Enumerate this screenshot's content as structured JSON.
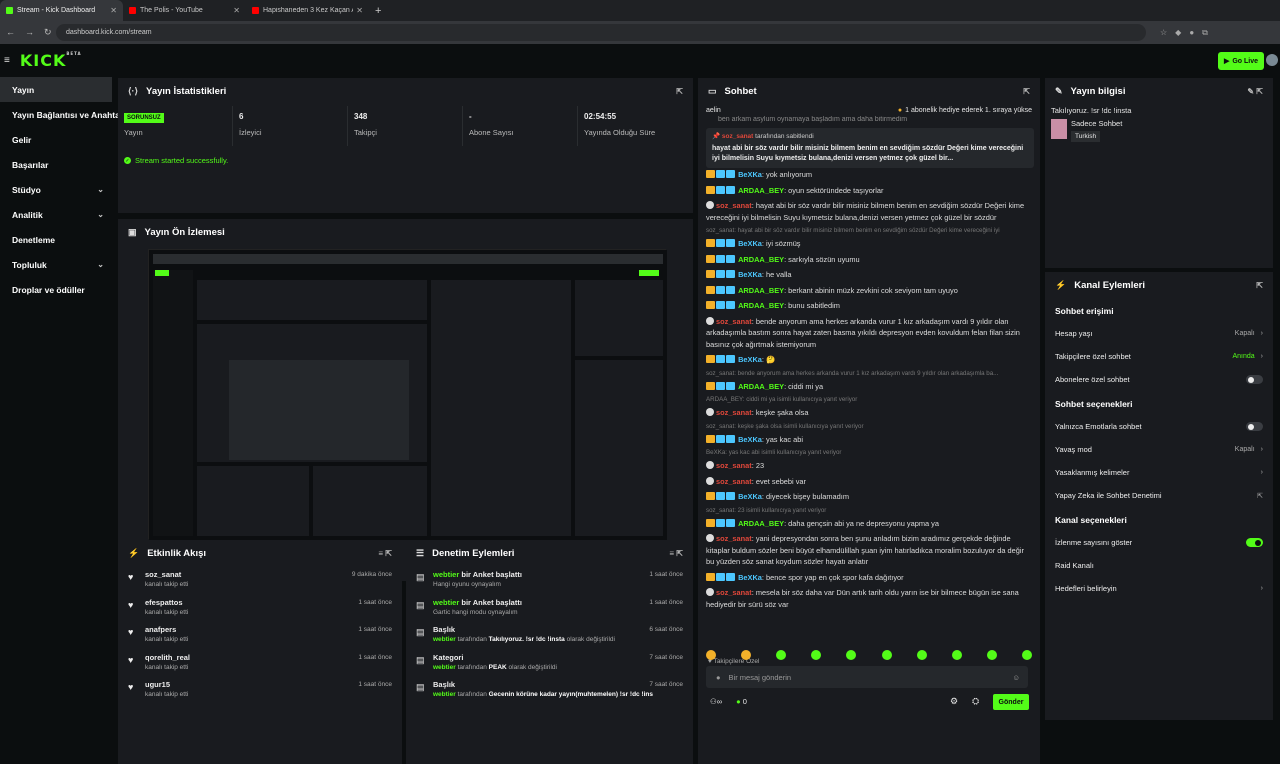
{
  "browser": {
    "tabs": [
      {
        "title": "Stream - Kick Dashboard",
        "active": true,
        "color": "#53fc18"
      },
      {
        "title": "The Polis - YouTube",
        "active": false,
        "color": "#ff0000"
      },
      {
        "title": "Hapishaneden 3 Kez Kaçan Ada",
        "active": false,
        "color": "#ff0000"
      }
    ],
    "url": "dashboard.kick.com/stream"
  },
  "app": {
    "logo": "KICK",
    "logo_tag": "BETA",
    "go_live": "Go Live"
  },
  "sidebar": {
    "items": [
      {
        "label": "Yayın",
        "active": true,
        "chevron": false
      },
      {
        "label": "Yayın Bağlantısı ve Anahtar",
        "active": false,
        "chevron": false
      },
      {
        "label": "Gelir",
        "active": false,
        "chevron": false
      },
      {
        "label": "Başarılar",
        "active": false,
        "chevron": false
      },
      {
        "label": "Stüdyo",
        "active": false,
        "chevron": true
      },
      {
        "label": "Analitik",
        "active": false,
        "chevron": true
      },
      {
        "label": "Denetleme",
        "active": false,
        "chevron": false
      },
      {
        "label": "Topluluk",
        "active": false,
        "chevron": true
      },
      {
        "label": "Droplar ve ödüller",
        "active": false,
        "chevron": false
      }
    ]
  },
  "stats": {
    "title": "Yayın İstatistikleri",
    "status_badge": "SORUNSUZ",
    "status_label": "Yayın",
    "viewers_value": "6",
    "viewers_label": "İzleyici",
    "followers_value": "348",
    "followers_label": "Takipçi",
    "subs_value": "-",
    "subs_label": "Abone Sayısı",
    "uptime_value": "02:54:55",
    "uptime_label": "Yayında Olduğu Süre",
    "message": "Stream started successfully."
  },
  "preview": {
    "title": "Yayın Ön İzlemesi"
  },
  "activity": {
    "title": "Etkinlik Akışı",
    "items": [
      {
        "name": "soz_sanat",
        "desc": "kanalı takip etti",
        "time": "9 dakika önce"
      },
      {
        "name": "efespattos",
        "desc": "kanalı takip etti",
        "time": "1 saat önce"
      },
      {
        "name": "anafpers",
        "desc": "kanalı takip etti",
        "time": "1 saat önce"
      },
      {
        "name": "qorelith_real",
        "desc": "kanalı takip etti",
        "time": "1 saat önce"
      },
      {
        "name": "ugur15",
        "desc": "kanalı takip etti",
        "time": "1 saat önce"
      }
    ]
  },
  "moderation": {
    "title": "Denetim Eylemleri",
    "items": [
      {
        "user": "webtier",
        "action": "bir Anket başlattı",
        "desc": "Hangi oyunu oynayalım",
        "time": "1 saat önce"
      },
      {
        "user": "webtier",
        "action": "bir Anket başlattı",
        "desc": "Gartic hangi modu oynayalım",
        "time": "1 saat önce"
      },
      {
        "user": "",
        "action": "Başlık",
        "desc_user": "webtier",
        "desc_mid": "tarafından",
        "desc_val": "Takılıyoruz. !sr !dc !insta",
        "desc_end": "olarak değiştirildi",
        "time": "6 saat önce"
      },
      {
        "user": "",
        "action": "Kategori",
        "desc_user": "webtier",
        "desc_mid": "tarafından",
        "desc_val": "PEAK",
        "desc_end": "olarak değiştirildi",
        "time": "7 saat önce"
      },
      {
        "user": "",
        "action": "Başlık",
        "desc_user": "webtier",
        "desc_mid": "tarafından",
        "desc_val": "Gecenin körüne kadar yayın(muhtemelen) !sr !dc !insta",
        "desc_end": "olarak değiştirildi",
        "time": "7 saat önce"
      }
    ]
  },
  "chat": {
    "title": "Sohbet",
    "top_left": "aelin",
    "top_right": "1 abonelik hediye ederek 1. sıraya yükse",
    "overflow_text": "ben arkam asylum oynamaya başladım ama daha bitirmedim",
    "pinned_by": "soz_sanat",
    "pinned_suffix": "tarafından sabitlendi",
    "pinned_text": "hayat abi bir söz vardır bilir misiniz bilmem benim en sevdiğim sözdür Değeri kime vereceğini iyi bilmelisin Suyu kıymetsiz bulana,denizi versen yetmez çok güzel bir...",
    "messages": [
      {
        "type": "msg",
        "user": "BeXKa",
        "color": "b",
        "badges": 3,
        "text": "yok anlıyorum"
      },
      {
        "type": "msg",
        "user": "ARDAA_BEY",
        "color": "g",
        "badges": 3,
        "text": "oyun sektöründede taşıyorlar"
      },
      {
        "type": "msg",
        "user": "soz_sanat",
        "color": "r",
        "badges": 0,
        "text": "hayat abi bir söz vardır bilir misiniz bilmem benim en sevdiğim sözdür Değeri kime vereceğini iyi bilmelisin Suyu kıymetsiz bulana,denizi versen yetmez çok güzel bir sözdür"
      },
      {
        "type": "reply",
        "text": "soz_sanat: hayat abi bir söz vardır bilir misiniz bilmem benim en sevdiğim sözdür Değeri kime vereceğini iyi"
      },
      {
        "type": "msg",
        "user": "BeXKa",
        "color": "b",
        "badges": 3,
        "text": "iyi sözmüş"
      },
      {
        "type": "msg",
        "user": "ARDAA_BEY",
        "color": "g",
        "badges": 3,
        "text": "sarkıyla sözün uyumu"
      },
      {
        "type": "msg",
        "user": "BeXKa",
        "color": "b",
        "badges": 3,
        "text": "he valla"
      },
      {
        "type": "msg",
        "user": "ARDAA_BEY",
        "color": "g",
        "badges": 3,
        "text": "berkant abinin müzk zevkini cok seviyom tam uyuyo"
      },
      {
        "type": "msg",
        "user": "ARDAA_BEY",
        "color": "g",
        "badges": 3,
        "text": "bunu sabitledim"
      },
      {
        "type": "msg",
        "user": "soz_sanat",
        "color": "r",
        "badges": 0,
        "text": "bende anyorum ama herkes arkanda vurur 1 kız arkadaşım vardı 9 yıldır olan arkadaşımla bastım sonra hayat zaten basma yıkıldı depresyon evden kovuldum felan filan sizin basınız çok ağırtmak istemiyorum"
      },
      {
        "type": "msg",
        "user": "BeXKa",
        "color": "b",
        "badges": 3,
        "text": "🤔"
      },
      {
        "type": "reply",
        "text": "soz_sanat: bende anyorum ama herkes arkanda vurur 1 kız arkadaşım vardı 9 yıldır olan arkadaşımla ba..."
      },
      {
        "type": "msg",
        "user": "ARDAA_BEY",
        "color": "g",
        "badges": 3,
        "text": "ciddi mi ya"
      },
      {
        "type": "reply",
        "text": "ARDAA_BEY: ciddi mi ya isimli kullanıcıya yanıt veriyor"
      },
      {
        "type": "msg",
        "user": "soz_sanat",
        "color": "r",
        "badges": 0,
        "text": "keşke şaka olsa"
      },
      {
        "type": "reply",
        "text": "soz_sanat: keşke şaka olsa isimli kullanıcıya yanıt veriyor"
      },
      {
        "type": "msg",
        "user": "BeXKa",
        "color": "b",
        "badges": 3,
        "text": "yas kac abi"
      },
      {
        "type": "reply",
        "text": "BeXKa: yas kac abi isimli kullanıcıya yanıt veriyor"
      },
      {
        "type": "msg",
        "user": "soz_sanat",
        "color": "r",
        "badges": 0,
        "text": "23"
      },
      {
        "type": "msg",
        "user": "soz_sanat",
        "color": "r",
        "badges": 0,
        "text": "evet sebebi var"
      },
      {
        "type": "msg",
        "user": "BeXKa",
        "color": "b",
        "badges": 3,
        "text": "diyecek bişey bulamadım"
      },
      {
        "type": "reply",
        "text": "soz_sanat: 23 isimli kullanıcıya yanıt veriyor"
      },
      {
        "type": "msg",
        "user": "ARDAA_BEY",
        "color": "g",
        "badges": 3,
        "text": "daha gençsin abi ya ne depresyonu yapma ya"
      },
      {
        "type": "msg",
        "user": "soz_sanat",
        "color": "r",
        "badges": 0,
        "text": "yani depresyondan sonra ben şunu anladım bizim aradımız gerçekde değinde kitaplar buldum sözler beni büyüt elhamdülillah şuan iyim hatırladıkca moralim bozuluyor da değir bu yüzden söz sanat koydum sözler hayatı anlatır"
      },
      {
        "type": "msg",
        "user": "BeXKa",
        "color": "b",
        "badges": 3,
        "text": "bence spor yap en çok spor kafa dağıtıyor"
      },
      {
        "type": "msg",
        "user": "soz_sanat",
        "color": "r",
        "badges": 0,
        "text": "mesela bir söz daha var Dün artık tarih oldu yarın ise bir bilmece bügün ise sana hediyedir bir sürü söz var"
      }
    ],
    "followers_only": "Takipçilere Özel",
    "input_placeholder": "Bir mesaj gönderin",
    "viewer_count": "0",
    "send": "Gönder"
  },
  "stream_info": {
    "title": "Yayın bilgisi",
    "stream_title": "Takılıyoruz. !sr !dc !insta",
    "category": "Sadece Sohbet",
    "language": "Turkish"
  },
  "channel_actions": {
    "title": "Kanal Eylemleri",
    "chat_access": "Sohbet erişimi",
    "account_age": "Hesap yaşı",
    "account_age_val": "Kapalı",
    "followers_chat": "Takipçilere özel sohbet",
    "followers_chat_val": "Anında",
    "subs_chat": "Abonelere özel sohbet",
    "chat_options": "Sohbet seçenekleri",
    "emotes_only": "Yalnızca Emotlarla sohbet",
    "slow_mode": "Yavaş mod",
    "slow_mode_val": "Kapalı",
    "banned_words": "Yasaklanmış kelimeler",
    "ai_moderation": "Yapay Zeka ile Sohbet Denetimi",
    "channel_options": "Kanal seçenekleri",
    "show_viewers": "İzlenme sayısını göster",
    "raid_channel": "Raid Kanalı",
    "set_goals": "Hedefleri belirleyin"
  }
}
